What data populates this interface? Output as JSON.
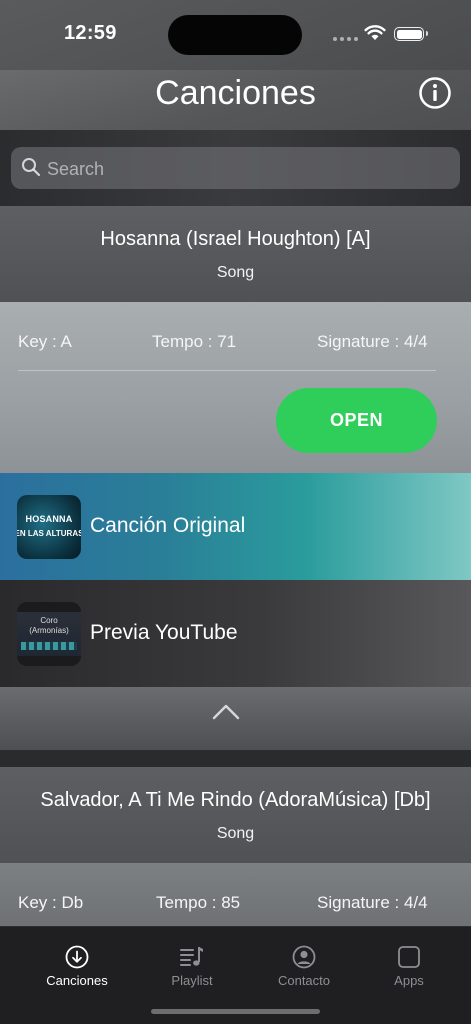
{
  "status": {
    "time": "12:59"
  },
  "header": {
    "title": "Canciones"
  },
  "search": {
    "placeholder": "Search"
  },
  "songs": [
    {
      "title": "Hosanna (Israel Houghton) [A]",
      "type": "Song",
      "key": "Key : A",
      "tempo": "Tempo : 71",
      "signature": "Signature : 4/4",
      "open_label": "OPEN",
      "media": [
        {
          "label": "Canción Original",
          "thumb_line1": "HOSANNA",
          "thumb_line2": "EN LAS ALTURAS"
        },
        {
          "label": "Previa YouTube",
          "thumb_line1": "Coro",
          "thumb_line2": "(Armonías)"
        }
      ]
    },
    {
      "title": "Salvador, A Ti Me Rindo (AdoraMúsica) [Db]",
      "type": "Song",
      "key": "Key : Db",
      "tempo": "Tempo : 85",
      "signature": "Signature : 4/4"
    }
  ],
  "tabs": [
    {
      "label": "Canciones",
      "icon": "arrow-down-circle-icon",
      "active": true
    },
    {
      "label": "Playlist",
      "icon": "music-list-icon",
      "active": false
    },
    {
      "label": "Contacto",
      "icon": "person-circle-icon",
      "active": false
    },
    {
      "label": "Apps",
      "icon": "square-icon",
      "active": false
    }
  ],
  "colors": {
    "open_button": "#2fce5a",
    "tab_active": "#ffffff",
    "tab_inactive": "#8e8e93"
  }
}
